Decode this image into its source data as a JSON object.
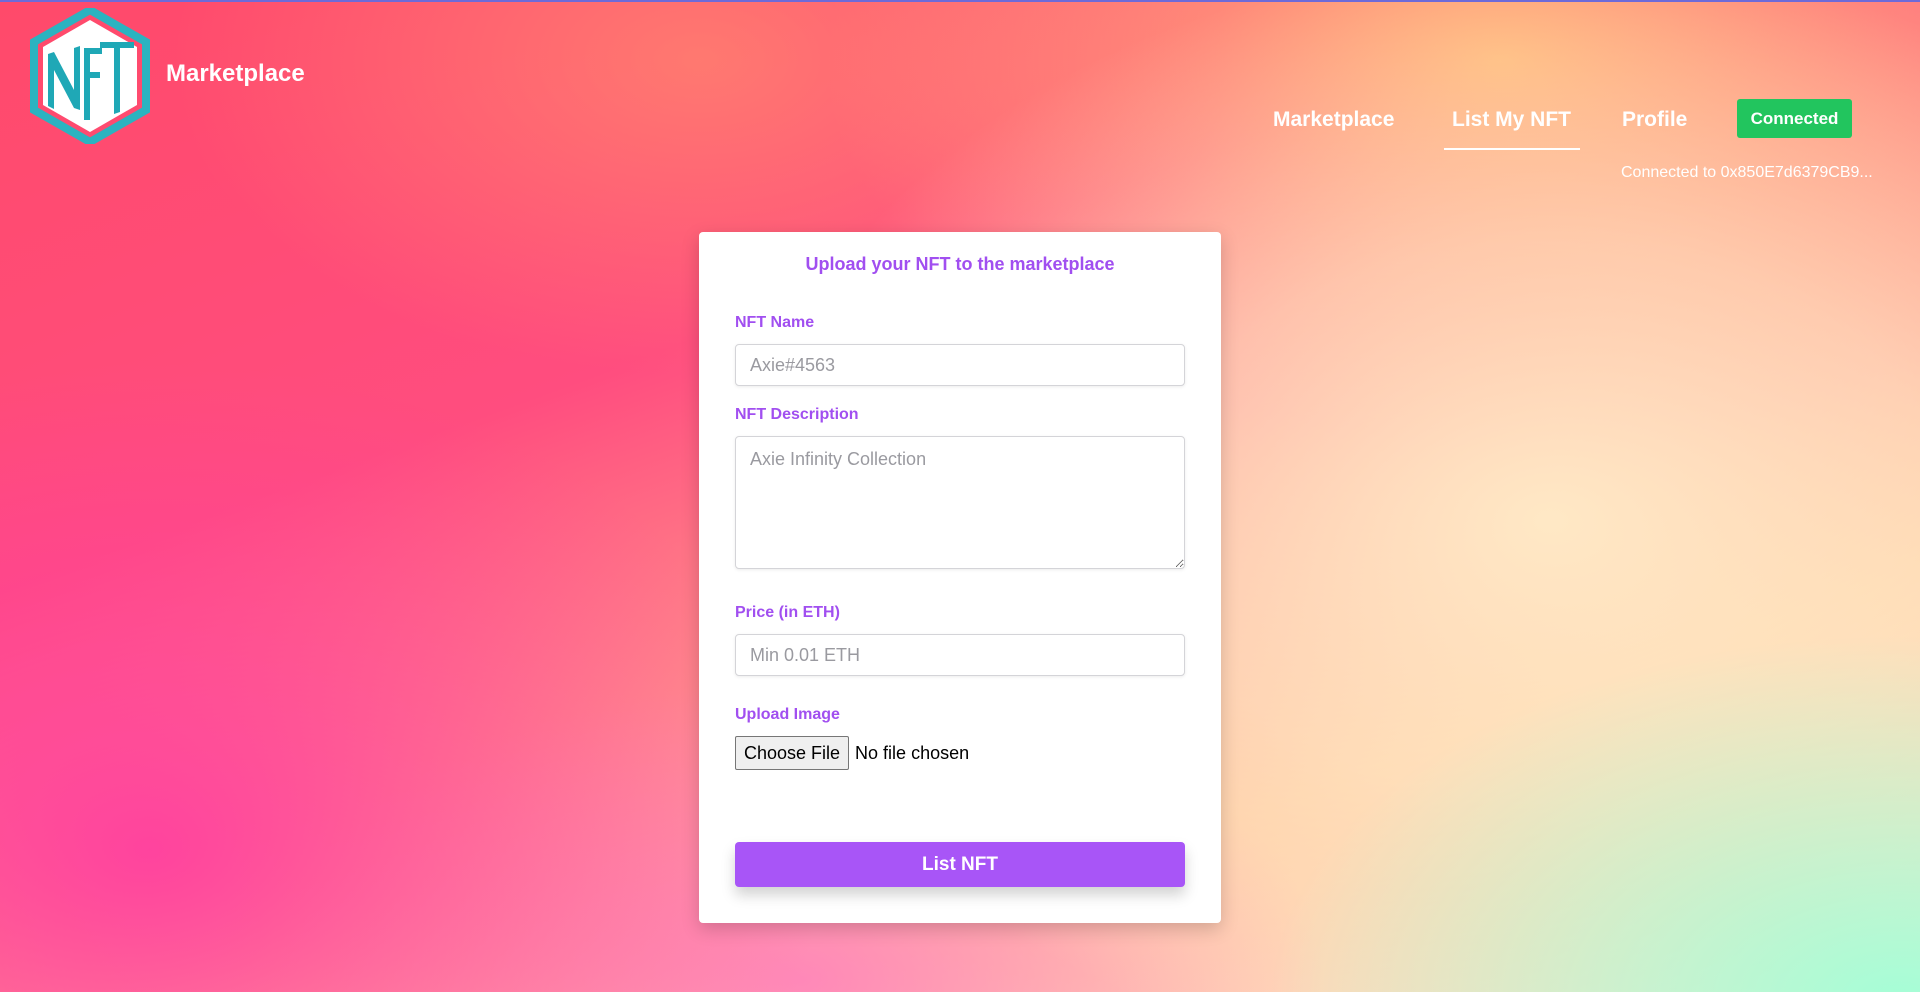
{
  "header": {
    "logo_text": "NFT",
    "brand": "Marketplace"
  },
  "nav": {
    "items": [
      {
        "label": "Marketplace"
      },
      {
        "label": "List My NFT"
      },
      {
        "label": "Profile"
      }
    ],
    "active": "List My NFT",
    "connect_button": "Connected",
    "connected_address": "Connected to 0x850E7d6379CB9..."
  },
  "form": {
    "title": "Upload your NFT to the marketplace",
    "name_label": "NFT Name",
    "name_placeholder": "Axie#4563",
    "description_label": "NFT Description",
    "description_placeholder": "Axie Infinity Collection",
    "price_label": "Price (in ETH)",
    "price_placeholder": "Min 0.01 ETH",
    "image_label": "Upload Image",
    "choose_file_button": "Choose File",
    "file_status": "No file chosen",
    "submit_button": "List NFT"
  },
  "colors": {
    "accent": "#a855f7",
    "label": "#a14ff0",
    "connected": "#22c55e",
    "logo": "#2bb3c0"
  }
}
